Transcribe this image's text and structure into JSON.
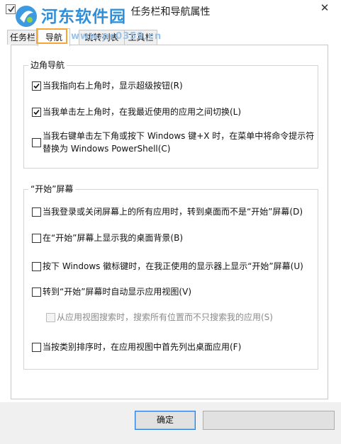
{
  "window": {
    "title": "任务栏和导航属性",
    "close_label": "✕"
  },
  "watermark": {
    "name": "河东软件园",
    "url": "www.pc0359.cn"
  },
  "tabs": [
    {
      "label": "任务栏",
      "selected": false
    },
    {
      "label": "导航",
      "selected": true
    },
    {
      "label": "跳转列表",
      "selected": false
    },
    {
      "label": "工具栏",
      "selected": false
    }
  ],
  "corner_nav": {
    "title": "边角导航",
    "options": [
      {
        "text": "当我指向右上角时，显示超级按钮(R)",
        "checked": true,
        "disabled": false
      },
      {
        "text": "当我单击左上角时，在我最近使用的应用之间切换(L)",
        "checked": true,
        "disabled": false
      },
      {
        "text": "当我右键单击左下角或按下 Windows 键+X 时，在菜单中将命令提示符",
        "text2": "替换为 Windows PowerShell(C)",
        "checked": false,
        "disabled": false
      }
    ]
  },
  "start_screen": {
    "title": "“开始”屏幕",
    "options": [
      {
        "text": "当我登录或关闭屏幕上的所有应用时，转到桌面而不是“开始”屏幕(D)",
        "checked": false,
        "disabled": false
      },
      {
        "text": "在“开始”屏幕上显示我的桌面背景(B)",
        "checked": false,
        "disabled": false
      },
      {
        "text": "按下 Windows 徽标键时，在我正使用的显示器上显示“开始”屏幕(U)",
        "checked": false,
        "disabled": false
      },
      {
        "text": "转到“开始”屏幕时自动显示应用视图(V)",
        "checked": false,
        "disabled": false
      },
      {
        "text": "从应用视图搜索时，搜索所有位置而不只搜索我的应用(S)",
        "checked": false,
        "disabled": true
      },
      {
        "text": "当按类别排序时，在应用视图中首先列出桌面应用(F)",
        "checked": false,
        "disabled": false
      }
    ]
  },
  "buttons": {
    "ok": "确定"
  }
}
